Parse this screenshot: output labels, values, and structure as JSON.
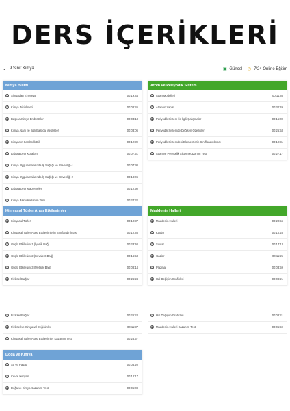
{
  "banner": "DERS İÇERİKLERİ",
  "course": {
    "chevron_icon": "chevron-down-icon",
    "title": "9.Sınıf Kimya",
    "current_label": "Güncel",
    "progress_label": "7/24 Online Eğitim"
  },
  "sections": [
    {
      "title": "Kimya Bilimi",
      "color": "#6fa3d6",
      "items": [
        {
          "label": "Simyadan Kimyaya",
          "dur": "00:19:44"
        },
        {
          "label": "Kimya Disiplinleri",
          "dur": "00:08:26"
        },
        {
          "label": "Başlıca Kimya Endüstrileri",
          "dur": "00:04:13"
        },
        {
          "label": "Kimya Alanı İle İlgili Başlıca Meslekler",
          "dur": "00:03:06"
        },
        {
          "label": "Kimyanın Sembolik Dili",
          "dur": "00:12:39"
        },
        {
          "label": "Laboratuvar Kuralları",
          "dur": "00:07:51"
        },
        {
          "label": "Kimya Uygulamalarında İş Sağlığı ve Güvenliği-1",
          "dur": "00:07:30"
        },
        {
          "label": "Kimya Uygulamalarında İş Sağlığı ve Güvenliği-2",
          "dur": "00:18:06"
        },
        {
          "label": "Laboratuvar Malzemeleri",
          "dur": "00:12:50"
        },
        {
          "label": "Kimya Bilimi Kazanım Testi",
          "dur": "00:24:32"
        }
      ]
    },
    {
      "title": "Atom ve Periyodik Sistem",
      "color": "#43a72a",
      "items": [
        {
          "label": "Atom Modelleri",
          "dur": "00:11:46"
        },
        {
          "label": "Atomun Yapısı",
          "dur": "00:30:49"
        },
        {
          "label": "Periyodik Sistem İle İlgili Çalışmalar",
          "dur": "00:15:00"
        },
        {
          "label": "Periyodik Sistemde Değişen Özellikler",
          "dur": "00:25:53"
        },
        {
          "label": "Periyodik Sistemdeki Elementlerin Sınıflandırılması",
          "dur": "00:19:31"
        },
        {
          "label": "Atom ve Periyodik Sistem Kazanım Testi",
          "dur": "00:27:17"
        }
      ]
    },
    {
      "title": "Kimyasal Türler Arası Etkileşimler",
      "color": "#6fa3d6",
      "items": [
        {
          "label": "Kimyasal Türler",
          "dur": "00:10:37"
        },
        {
          "label": "Kimyasal Türler Arası Etkileşimlerin Sınıflandırılması",
          "dur": "00:12:46"
        },
        {
          "label": "Güçlü Etkileşim-1 (İyonik Bağ)",
          "dur": "00:23:40"
        },
        {
          "label": "Güçlü Etkileşim-2 (Kovalent Bağ)",
          "dur": "00:16:53"
        },
        {
          "label": "Güçlü Etkileşim-3 (Metalik Bağ)",
          "dur": "00:08:14"
        },
        {
          "label": "Fiziksel Bağlar",
          "dur": "00:26:24"
        }
      ]
    },
    {
      "title": "Maddenin Halleri",
      "color": "#43a72a",
      "items": [
        {
          "label": "Maddenin Halleri",
          "dur": "00:20:56"
        },
        {
          "label": "Katılar",
          "dur": "00:10:28"
        },
        {
          "label": "Sıvılar",
          "dur": "00:14:13"
        },
        {
          "label": "Gazlar",
          "dur": "00:11:25"
        },
        {
          "label": "Plazma",
          "dur": "00:03:59"
        },
        {
          "label": "Hal Değişim Grafikleri",
          "dur": "00:08:21"
        }
      ]
    }
  ],
  "continued_left": [
    {
      "label": "Fiziksel Bağlar",
      "dur": "00:26:24"
    },
    {
      "label": "Fiziksel ve Kimyasal Değişimler",
      "dur": "00:11:37"
    },
    {
      "label": "Kimyasal Türler Arası Etkileşimler Kazanım Testi",
      "dur": "00:25:57"
    }
  ],
  "continued_right": [
    {
      "label": "Hal Değişim Grafikleri",
      "dur": "00:08:21"
    },
    {
      "label": "Maddenin Halleri Kazanım Testi",
      "dur": "00:05:59"
    }
  ],
  "last_section": {
    "title": "Doğa ve Kimya",
    "color": "#6fa3d6",
    "items": [
      {
        "label": "Su ve Hayat",
        "dur": "00:05:20"
      },
      {
        "label": "Çevre Kimyası",
        "dur": "00:12:17"
      },
      {
        "label": "Doğa ve Kimya Kazanım Testi",
        "dur": "00:05:08"
      }
    ]
  }
}
